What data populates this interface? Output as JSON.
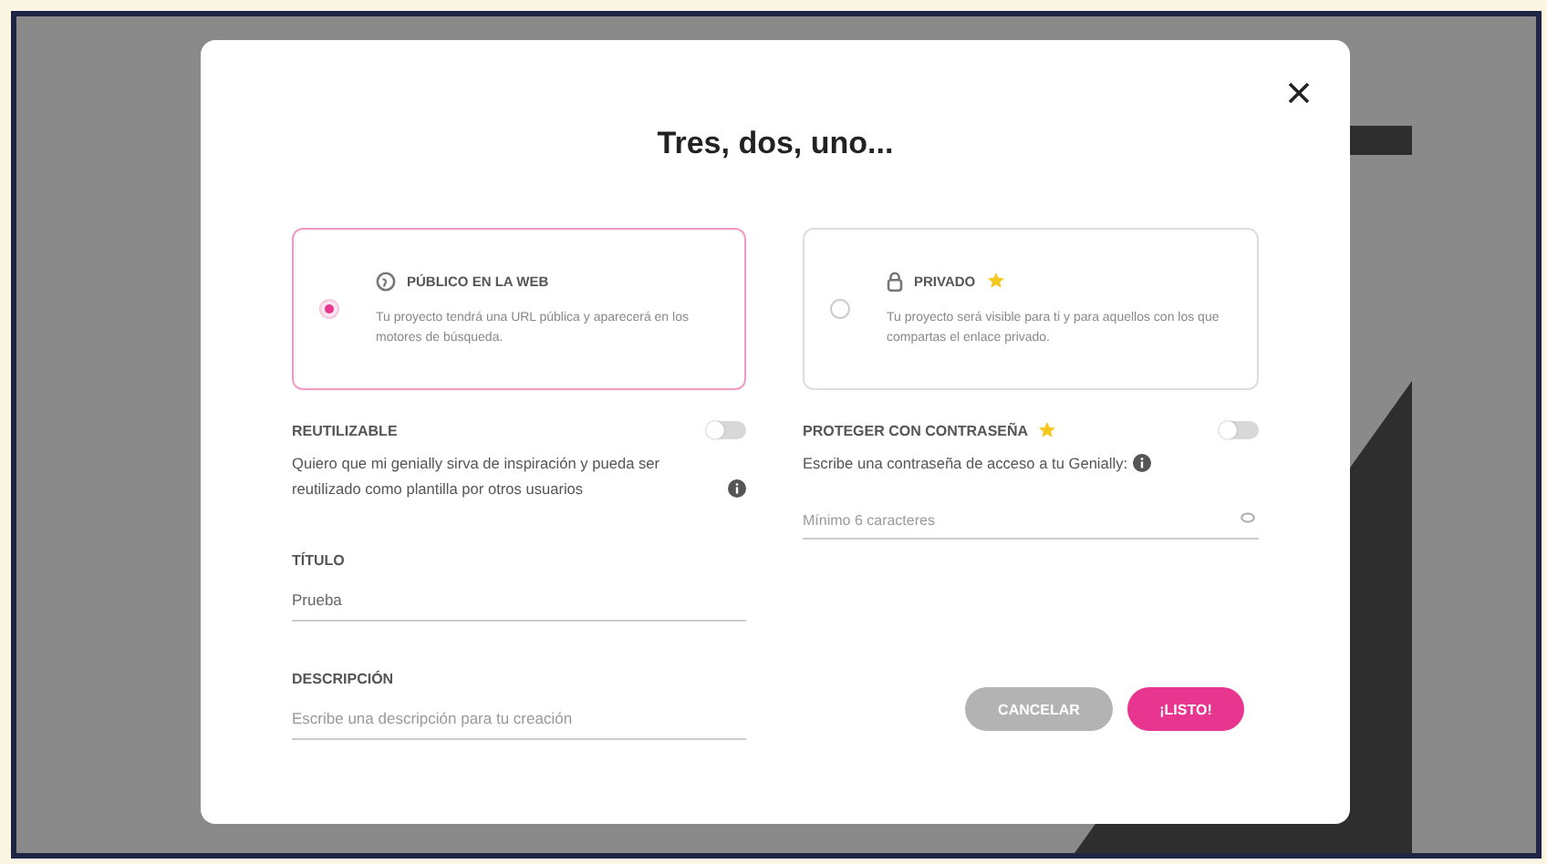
{
  "dialog": {
    "title": "Tres, dos, uno...",
    "visibility_options": [
      {
        "kind": "public",
        "label": "PÚBLICO EN LA WEB",
        "premium": false,
        "selected": true,
        "description": "Tu proyecto tendrá una URL pública y aparecerá en los motores de búsqueda."
      },
      {
        "kind": "private",
        "label": "PRIVADO",
        "premium": true,
        "selected": false,
        "description": "Tu proyecto será visible para ti y para aquellos con los que compartas el enlace privado."
      }
    ],
    "reuse": {
      "label": "REUTILIZABLE",
      "on": false,
      "description": "Quiero que mi genially sirva de inspiración y pueda ser reutilizado como plantilla por otros usuarios"
    },
    "password": {
      "label": "PROTEGER CON CONTRASEÑA",
      "premium": true,
      "on": false,
      "description": "Escribe una contraseña de acceso a tu Genially:",
      "placeholder": "Mínimo 6 caracteres"
    },
    "title_field": {
      "label": "TÍTULO",
      "value": "Prueba"
    },
    "description_field": {
      "label": "DESCRIPCIÓN",
      "placeholder": "Escribe una descripción para tu creación"
    },
    "buttons": [
      {
        "kind": "cancel",
        "label": "CANCELAR"
      },
      {
        "kind": "confirm",
        "label": "¡LISTO!"
      }
    ]
  }
}
